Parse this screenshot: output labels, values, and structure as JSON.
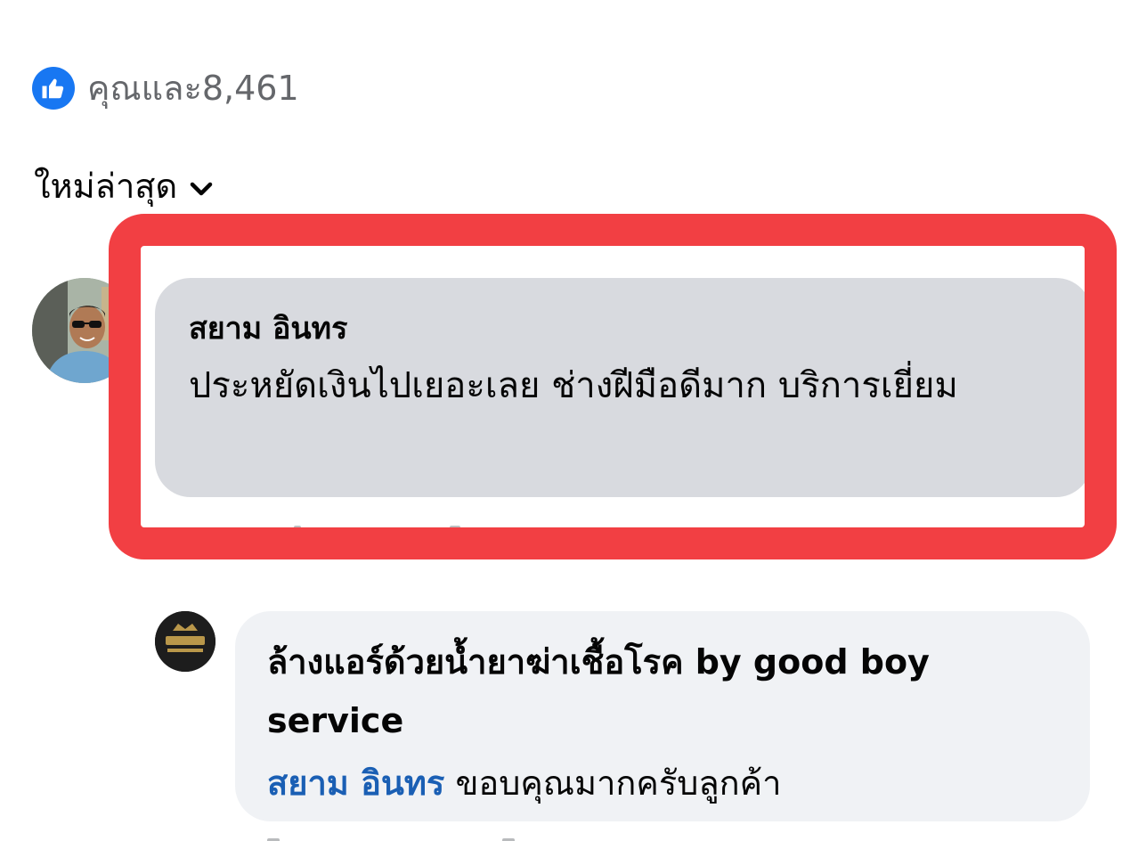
{
  "reactions": {
    "icon": "like-icon",
    "text": "คุณและ8,461",
    "color": "#1877f2"
  },
  "sort": {
    "label": "ใหม่ล่าสุด",
    "icon": "chevron-down-icon"
  },
  "comment": {
    "author": "สยาม อินทร",
    "text": "ประหยัดเงินไปเยอะเลย ช่างฝีมือดีมาก บริการเยี่ยม",
    "bubble_color": "#d8dadf"
  },
  "reply": {
    "author": "ล้างแอร์ด้วยน้ำยาฆ่าเชื้อโรค by good boy service",
    "mention": "สยาม อินทร",
    "text": "ขอบคุณมากครับลูกค้า",
    "mention_color": "#1a5fb4"
  },
  "highlight": {
    "color": "#f23f43"
  }
}
